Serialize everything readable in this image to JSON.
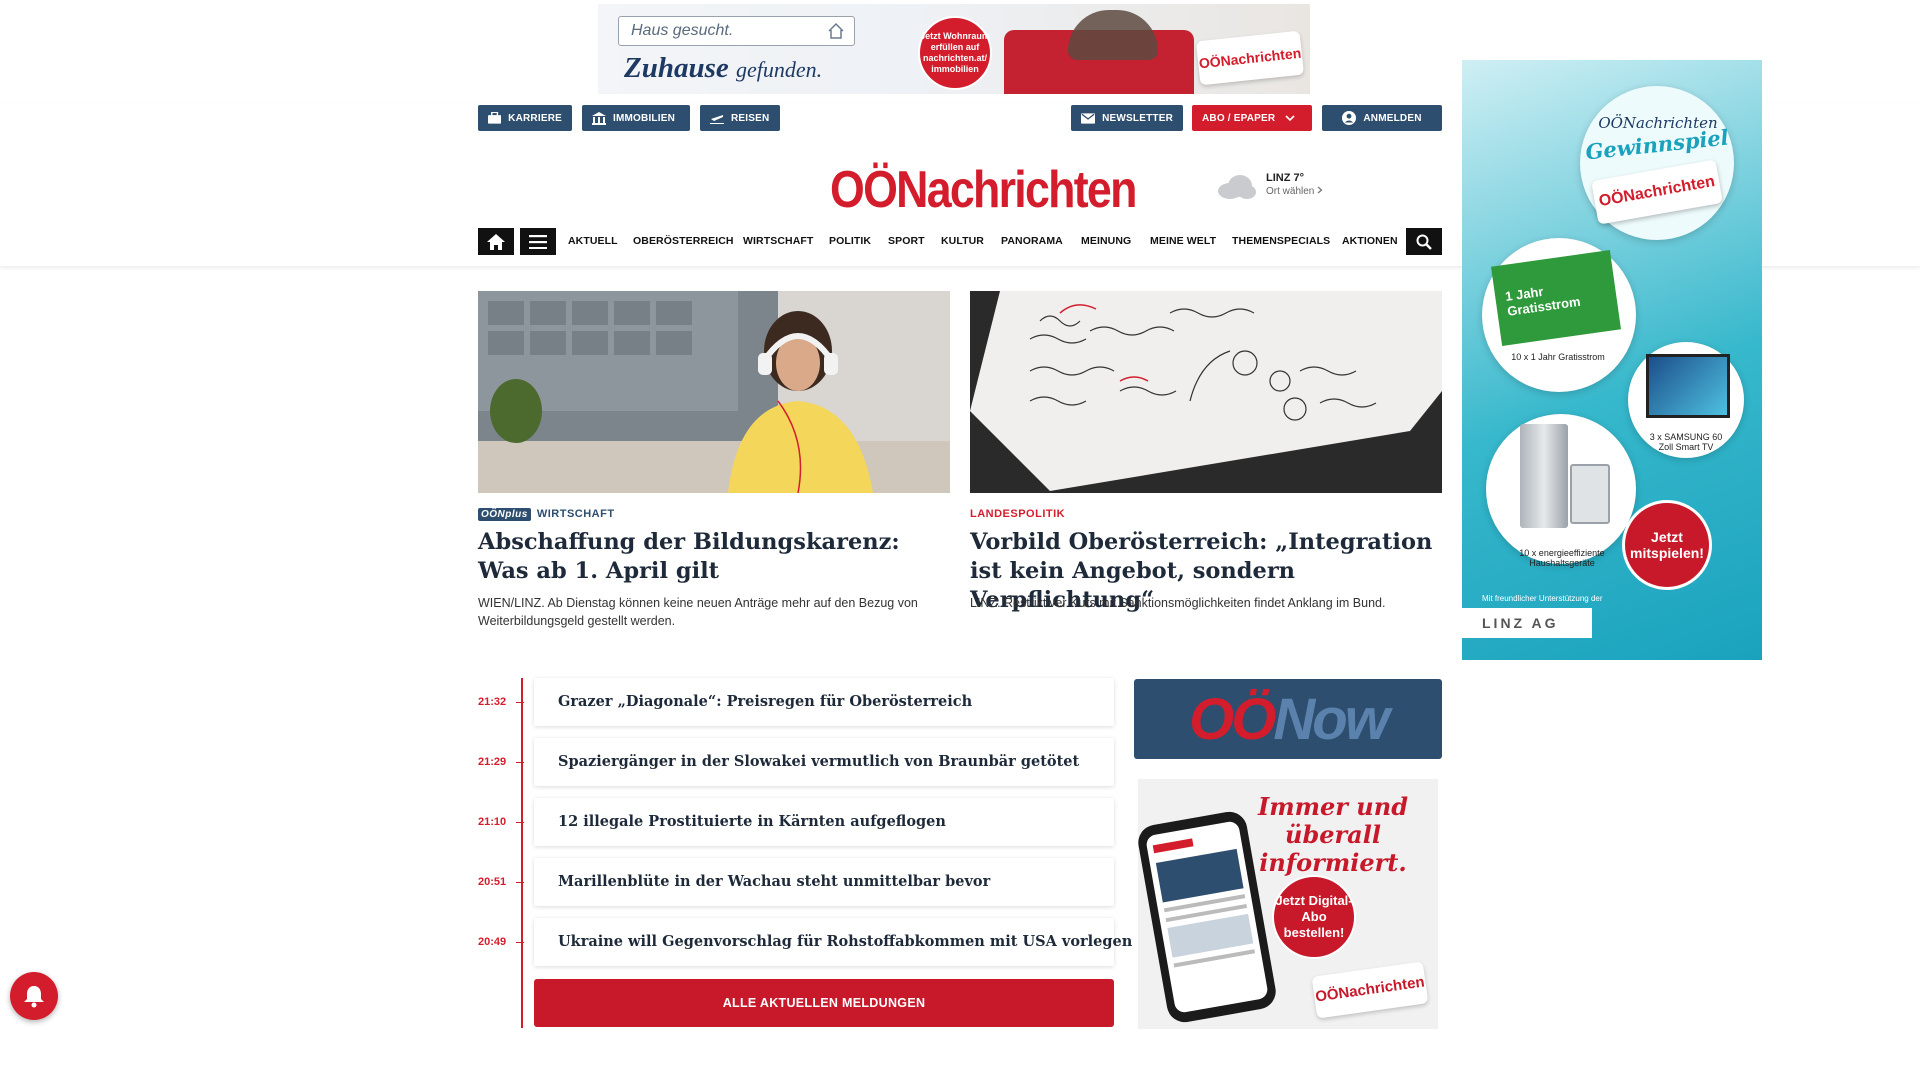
{
  "top_ad": {
    "search_text": "Haus gesucht.",
    "slogan_main": "Zuhause",
    "slogan_sub": "gefunden.",
    "badge": "Jetzt Wohnraum erfüllen auf nachrichten.at/ immobilien",
    "brand": "OÖNachrichten"
  },
  "services": {
    "karriere": "KARRIERE",
    "immobilien": "IMMOBILIEN",
    "reisen": "REISEN",
    "newsletter": "NEWSLETTER",
    "abo": "ABO / EPAPER",
    "login": "ANMELDEN"
  },
  "logo": {
    "oo": "OÖ",
    "rest": "Nachrichten"
  },
  "weather": {
    "city": "LINZ 7°",
    "select": "Ort wählen"
  },
  "nav": [
    "AKTUELL",
    "OBERÖSTERREICH",
    "WIRTSCHAFT",
    "POLITIK",
    "SPORT",
    "KULTUR",
    "PANORAMA",
    "MEINUNG",
    "MEINE WELT",
    "THEMENSPECIALS",
    "AKTIONEN"
  ],
  "articles": [
    {
      "badge": "OÖNplus",
      "kicker": "WIRTSCHAFT",
      "headline": "Abschaffung der Bildungskarenz: Was ab 1. April gilt",
      "teaser": "WIEN/LINZ. Ab Dienstag können keine neuen Anträge mehr auf den Bezug von Weiterbildungsgeld gestellt werden."
    },
    {
      "kicker": "LANDESPOLITIK",
      "headline": "Vorbild Oberösterreich: „Integration ist kein Angebot, sondern Verpflichtung“",
      "teaser": "LINZ. Restriktiver Kurs mit Sanktionsmöglichkeiten findet Anklang im Bund."
    }
  ],
  "ticker": [
    {
      "time": "21:32",
      "title": "Grazer „Diagonale“: Preisregen für Oberösterreich"
    },
    {
      "time": "21:29",
      "title": "Spaziergänger in der Slowakei vermutlich von Braunbär getötet"
    },
    {
      "time": "21:10",
      "title": "12 illegale Prostituierte in Kärnten aufgeflogen"
    },
    {
      "time": "20:51",
      "title": "Marillenblüte in der Wachau steht unmittelbar bevor"
    },
    {
      "time": "20:49",
      "title": "Ukraine will Gegenvorschlag für Rohstoffabkommen mit USA vorlegen"
    }
  ],
  "all_news_label": "ALLE AKTUELLEN MELDUNGEN",
  "oonow": {
    "oo": "OÖ",
    "now": "Now"
  },
  "abo_ad": {
    "title": "Immer und überall informiert.",
    "circle": "Jetzt Digital-Abo bestellen!",
    "brand": "OÖNachrichten"
  },
  "side_ad": {
    "title_top": "OÖNachrichten",
    "title_main": "Gewinnspiel",
    "brand": "OÖNachrichten",
    "prize1": "10 x 1 Jahr Gratisstrom",
    "prize1_card": "1 Jahr Gratisstrom",
    "prize2": "3 x SAMSUNG 60 Zoll Smart TV",
    "prize3": "10 x energieeffiziente Haushaltsgeräte",
    "cta": "Jetzt mitspielen!",
    "sponsor_note": "Mit freundlicher Unterstützung der",
    "sponsor": "LINZ AG"
  },
  "colors": {
    "brand_red": "#d41d2c",
    "brand_blue": "#2d4e6e"
  }
}
